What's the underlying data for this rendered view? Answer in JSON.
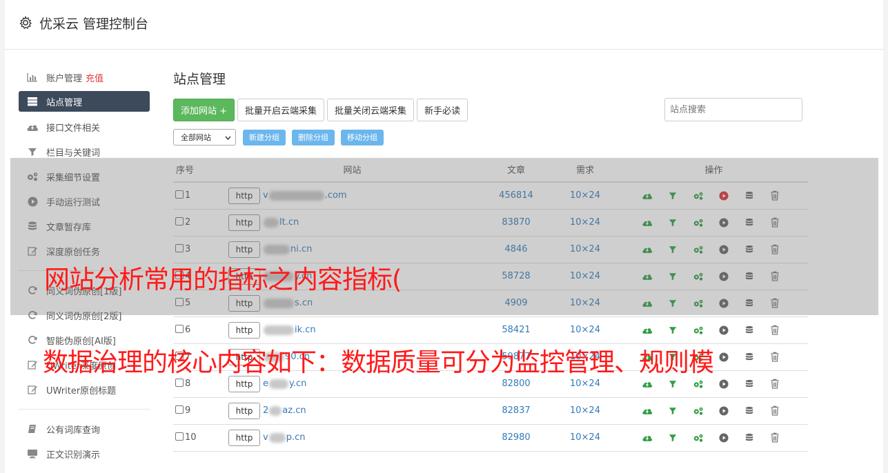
{
  "app": {
    "title": "优采云 管理控制台"
  },
  "sidebar": {
    "items": [
      {
        "label": "账户管理",
        "extra": "充值",
        "icon": "bar-chart-icon",
        "active": false
      },
      {
        "label": "站点管理",
        "icon": "server-icon",
        "active": true
      },
      {
        "label": "接口文件相关",
        "icon": "cloud-upload-icon",
        "active": false
      },
      {
        "label": "栏目与关键词",
        "icon": "filter-icon",
        "active": false
      },
      {
        "label": "采集细节设置",
        "icon": "gears-icon",
        "active": false
      },
      {
        "label": "手动运行测试",
        "icon": "play-circle-icon",
        "active": false
      },
      {
        "label": "文章暂存库",
        "icon": "database-icon",
        "active": false
      },
      {
        "label": "深度原创任务",
        "icon": "edit-icon",
        "active": false
      }
    ],
    "items2": [
      {
        "label": "同义词伪原创[1版]",
        "icon": "refresh-icon"
      },
      {
        "label": "同义词伪原创[2版]",
        "icon": "refresh-icon"
      },
      {
        "label": "智能伪原创[AI版]",
        "icon": "refresh-icon"
      },
      {
        "label": "UWriter深度原创",
        "icon": "edit-icon"
      },
      {
        "label": "UWriter原创标题",
        "icon": "edit-icon"
      }
    ],
    "items3": [
      {
        "label": "公有词库查询",
        "icon": "book-icon"
      },
      {
        "label": "正文识别演示",
        "icon": "monitor-icon"
      }
    ]
  },
  "main": {
    "page_title": "站点管理",
    "toolbar": {
      "add_label": "添加网站 +",
      "batch_on_label": "批量开启云端采集",
      "batch_off_label": "批量关闭云端采集",
      "guide_label": "新手必读",
      "search_placeholder": "站点搜索"
    },
    "group_select": "全部网站",
    "group_buttons": [
      "新建分组",
      "删除分组",
      "移动分组"
    ],
    "table": {
      "headers": [
        "序号",
        "网站",
        "文章",
        "需求",
        "操作"
      ],
      "rows": [
        {
          "idx": "1",
          "http": "http",
          "prefix": "v",
          "suffix": ".com",
          "blur_w": 80,
          "articles": "456814",
          "demand": "10×24",
          "running": true
        },
        {
          "idx": "2",
          "http": "http",
          "prefix": "",
          "suffix": "lt.cn",
          "blur_w": 22,
          "articles": "83870",
          "demand": "10×24",
          "running": false
        },
        {
          "idx": "3",
          "http": "http",
          "prefix": "",
          "suffix": "ni.cn",
          "blur_w": 38,
          "articles": "4846",
          "demand": "10×24",
          "running": false
        },
        {
          "idx": "4",
          "http": "http",
          "prefix": "",
          "suffix": "y.cn",
          "blur_w": 44,
          "articles": "58728",
          "demand": "10×24",
          "running": false
        },
        {
          "idx": "5",
          "http": "http",
          "prefix": "",
          "suffix": "s.cn",
          "blur_w": 44,
          "articles": "4909",
          "demand": "10×24",
          "running": false
        },
        {
          "idx": "6",
          "http": "http",
          "prefix": "",
          "suffix": "ik.cn",
          "blur_w": 44,
          "articles": "58421",
          "demand": "10×24",
          "running": false
        },
        {
          "idx": "7",
          "http": "http",
          "prefix": "",
          "suffix": "90.cn",
          "blur_w": 30,
          "articles": "59877",
          "demand": "10×24",
          "running": false
        },
        {
          "idx": "8",
          "http": "http",
          "prefix": "e",
          "suffix": "y.cn",
          "blur_w": 28,
          "articles": "82800",
          "demand": "10×24",
          "running": false
        },
        {
          "idx": "9",
          "http": "http",
          "prefix": "2",
          "suffix": "az.cn",
          "blur_w": 18,
          "articles": "82837",
          "demand": "10×24",
          "running": false
        },
        {
          "idx": "10",
          "http": "http",
          "prefix": "v",
          "suffix": "p.cn",
          "blur_w": 24,
          "articles": "82980",
          "demand": "10×24",
          "running": false
        }
      ]
    }
  },
  "overlay": {
    "caption_1": "网站分析常用的指标之内容指标(",
    "caption_2": "数据治理的核心内容如下：数据质量可分为监控管理、规则模"
  },
  "colors": {
    "accent_green": "#5cb85c",
    "link_blue": "#337ab7",
    "sidebar_active": "#3d4a5c",
    "caption_red": "#ff1a1a",
    "recharge_red": "#e4393c"
  }
}
